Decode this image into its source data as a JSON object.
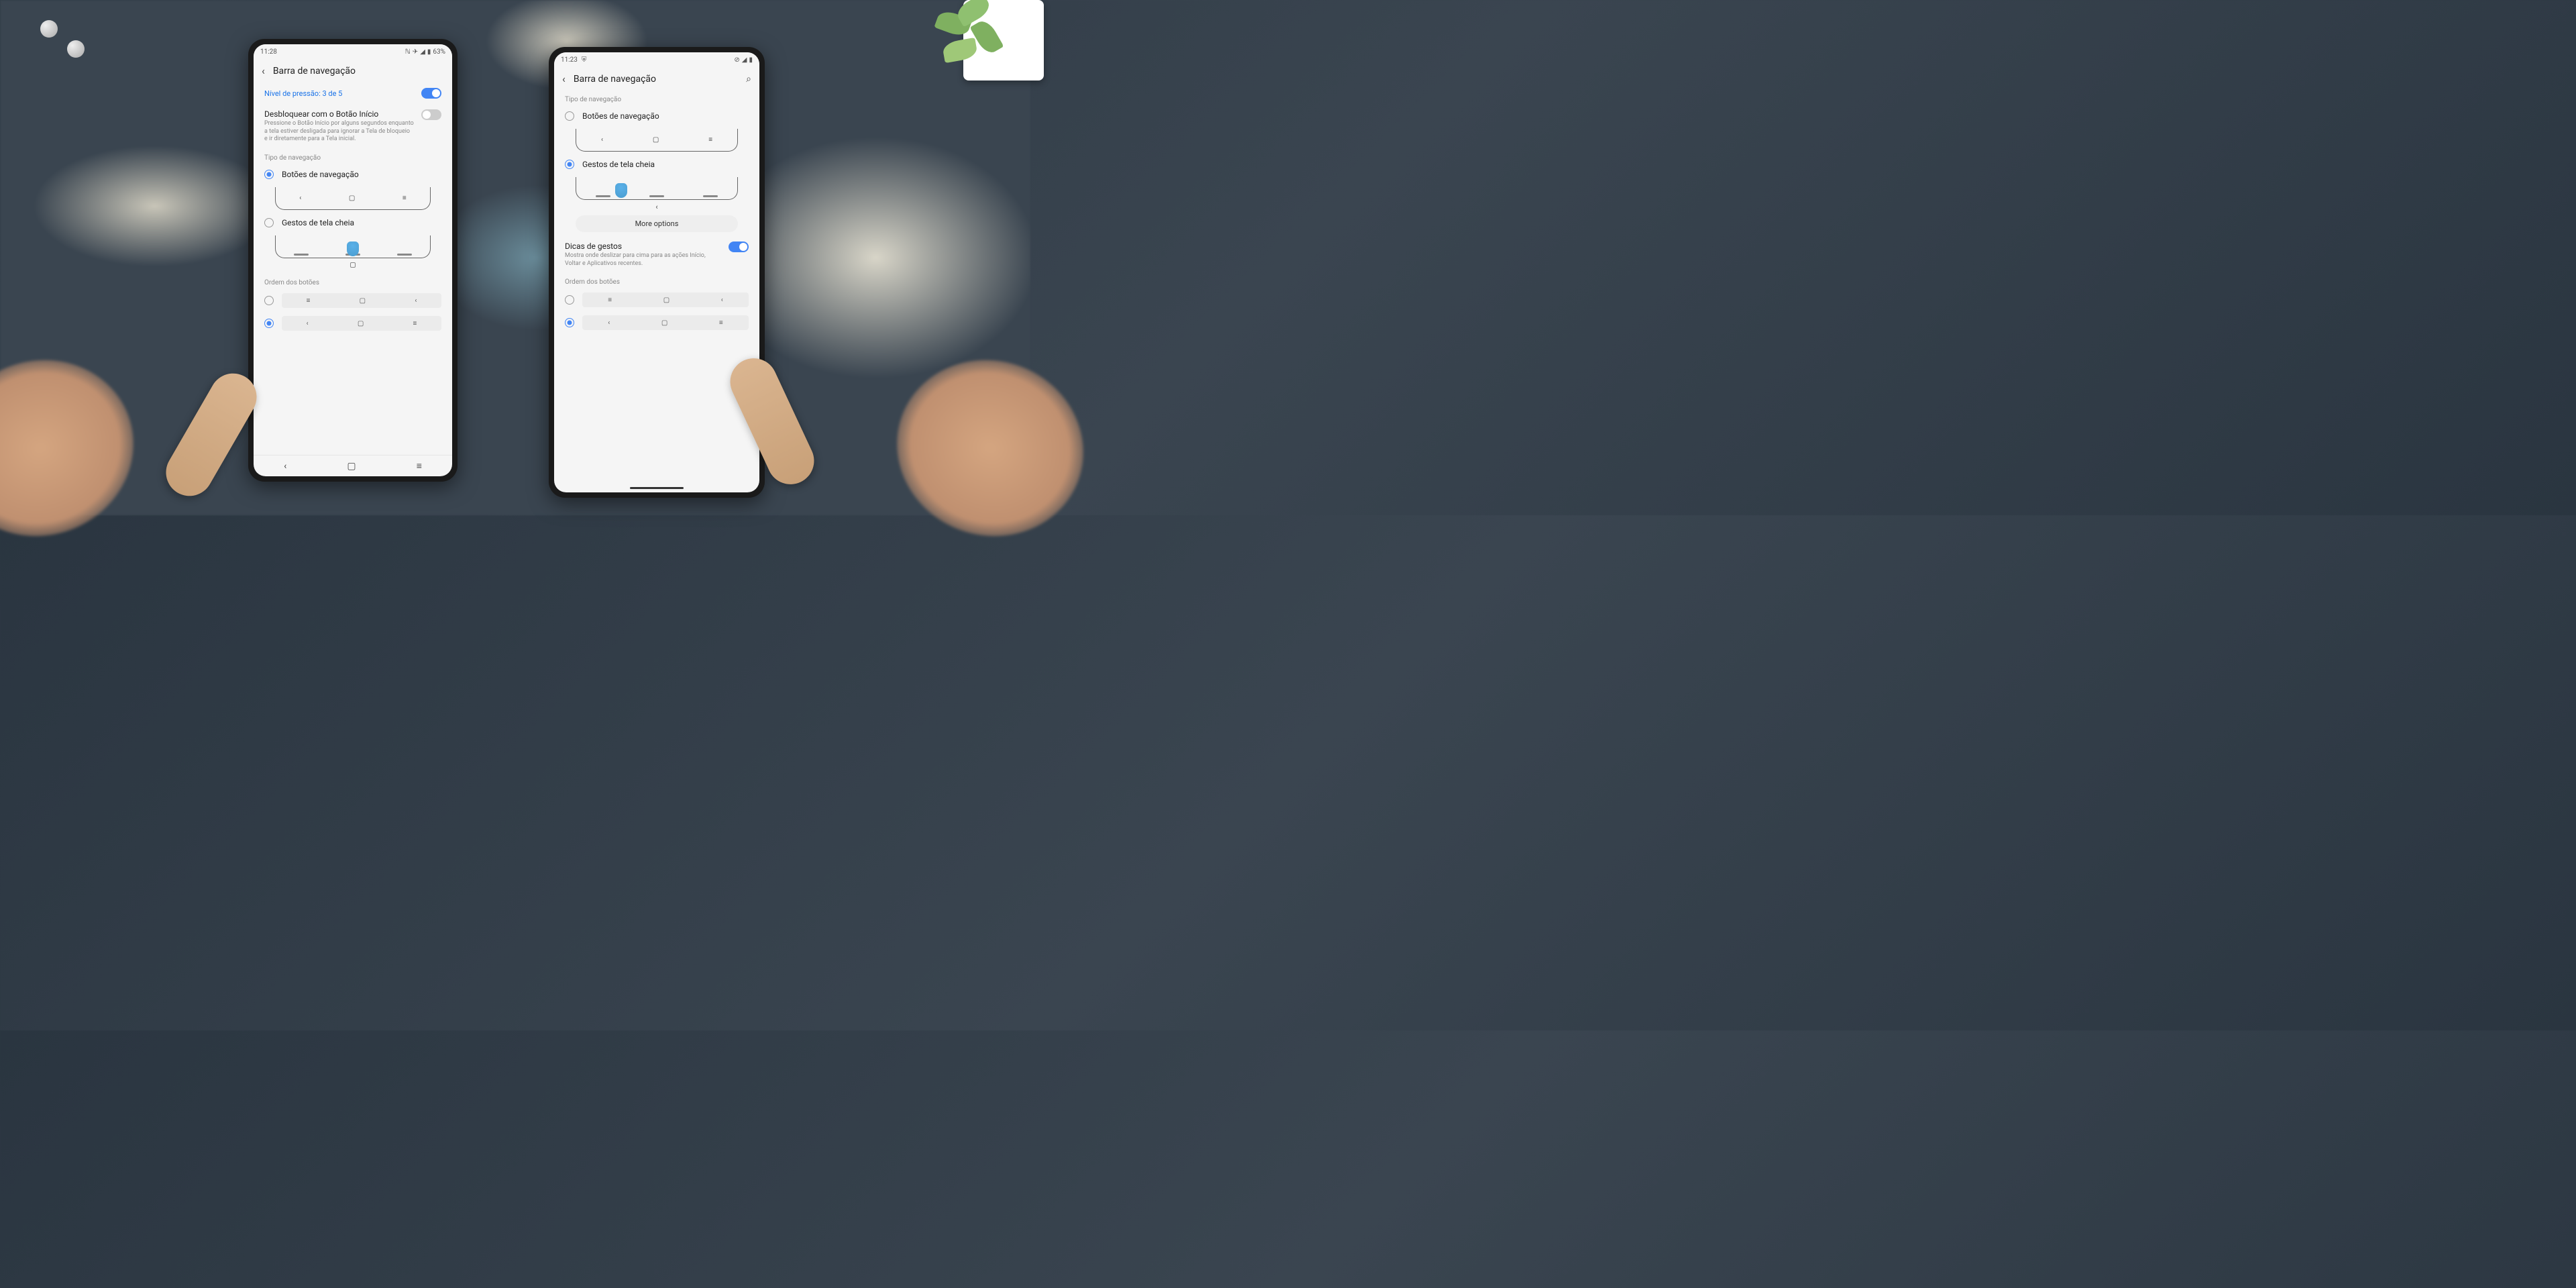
{
  "left_phone": {
    "status": {
      "time": "11:28",
      "battery": "63%",
      "icons": "✈ ◢ ▮"
    },
    "header": {
      "title": "Barra de navegação"
    },
    "pressure": {
      "label": "Nível de pressão: 3 de 5",
      "on": true
    },
    "unlock": {
      "title": "Desbloquear com o Botão Início",
      "desc": "Pressione o Botão Início por alguns segundos enquanto a tela estiver desligada para ignorar a Tela de bloqueio e ir diretamente para a Tela inicial.",
      "on": false
    },
    "nav_type": {
      "section": "Tipo de navegação",
      "buttons": "Botões de navegação",
      "gestures": "Gestos de tela cheia",
      "selected": "buttons"
    },
    "button_order": {
      "section": "Ordem dos botões",
      "selected": 1
    }
  },
  "right_phone": {
    "status": {
      "time": "11:23",
      "icons": "◯ ◢ ▮"
    },
    "header": {
      "title": "Barra de navegação"
    },
    "nav_type": {
      "section": "Tipo de navegação",
      "buttons": "Botões de navegação",
      "gestures": "Gestos de tela cheia",
      "selected": "gestures",
      "more_options": "More options"
    },
    "gesture_hints": {
      "title": "Dicas de gestos",
      "desc": "Mostra onde deslizar para cima para as ações Início, Voltar e Aplicativos recentes.",
      "on": true
    },
    "button_order": {
      "section": "Ordem dos botões",
      "selected": 1
    }
  }
}
